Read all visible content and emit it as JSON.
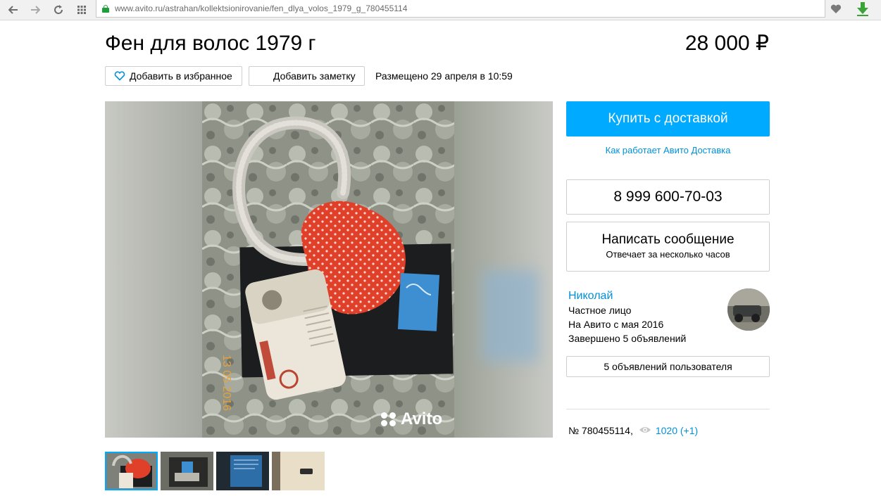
{
  "browser": {
    "url_host": "www.avito.ru",
    "url_path": "/astrahan/kollektsionirovanie/fen_dlya_volos_1979_g_780455114"
  },
  "listing": {
    "title": "Фен для волос 1979 г",
    "price": "28 000 ₽",
    "favorite_label": "Добавить в избранное",
    "note_label": "Добавить заметку",
    "posted": "Размещено 29 апреля в 10:59",
    "photo_date_stamp": "13 05 2016",
    "watermark": "Avito"
  },
  "actions": {
    "buy_label": "Купить с доставкой",
    "how_delivery_label": "Как работает Авито Доставка",
    "phone": "8 999 600-70-03",
    "message_title": "Написать сообщение",
    "message_sub": "Отвечает за несколько часов"
  },
  "seller": {
    "name": "Николай",
    "type": "Частное лицо",
    "since": "На Авито с мая 2016",
    "completed": "Завершено 5 объявлений",
    "ads_button": "5 объявлений пользователя"
  },
  "meta": {
    "number": "№ 780455114,",
    "views": "1020 (+1)"
  },
  "colors": {
    "accent": "#00aaff",
    "link": "#0091d9"
  }
}
